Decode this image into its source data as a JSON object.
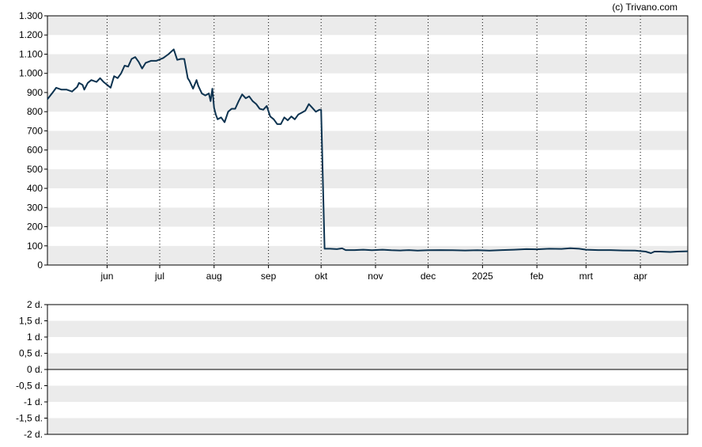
{
  "copyright": "(c) Trivano.com",
  "chart_data": [
    {
      "type": "line",
      "title": "",
      "xlabel": "",
      "ylabel": "",
      "ylim": [
        0,
        1300
      ],
      "y_ticks": [
        0,
        100,
        200,
        300,
        400,
        500,
        600,
        700,
        800,
        900,
        1000,
        1100,
        1200,
        1300
      ],
      "y_tick_labels": [
        "0",
        "100",
        "200",
        "300",
        "400",
        "500",
        "600",
        "700",
        "800",
        "900",
        "1.000",
        "1.100",
        "1.200",
        "1.300"
      ],
      "x_range": [
        "2024-04-28",
        "2025-04-28"
      ],
      "x_ticks": [
        {
          "label": "jun",
          "date": "2024-06-01"
        },
        {
          "label": "jul",
          "date": "2024-07-01"
        },
        {
          "label": "aug",
          "date": "2024-08-01"
        },
        {
          "label": "sep",
          "date": "2024-09-01"
        },
        {
          "label": "okt",
          "date": "2024-10-01"
        },
        {
          "label": "nov",
          "date": "2024-11-01"
        },
        {
          "label": "dec",
          "date": "2024-12-01"
        },
        {
          "label": "2025",
          "date": "2025-01-01"
        },
        {
          "label": "feb",
          "date": "2025-02-01"
        },
        {
          "label": "mrt",
          "date": "2025-03-01"
        },
        {
          "label": "apr",
          "date": "2025-04-01"
        }
      ],
      "grid": "horizontal alternating bands, vertical dotted lines at month ticks",
      "line_color": "#0d3350",
      "series": [
        {
          "points": [
            [
              "2024-04-28",
              865
            ],
            [
              "2024-05-01",
              900
            ],
            [
              "2024-05-03",
              925
            ],
            [
              "2024-05-06",
              915
            ],
            [
              "2024-05-09",
              915
            ],
            [
              "2024-05-12",
              905
            ],
            [
              "2024-05-15",
              930
            ],
            [
              "2024-05-16",
              950
            ],
            [
              "2024-05-18",
              940
            ],
            [
              "2024-05-19",
              915
            ],
            [
              "2024-05-21",
              950
            ],
            [
              "2024-05-23",
              965
            ],
            [
              "2024-05-26",
              955
            ],
            [
              "2024-05-28",
              975
            ],
            [
              "2024-05-30",
              955
            ],
            [
              "2024-06-01",
              940
            ],
            [
              "2024-06-03",
              925
            ],
            [
              "2024-06-05",
              985
            ],
            [
              "2024-06-07",
              975
            ],
            [
              "2024-06-09",
              1000
            ],
            [
              "2024-06-11",
              1040
            ],
            [
              "2024-06-13",
              1035
            ],
            [
              "2024-06-15",
              1075
            ],
            [
              "2024-06-17",
              1085
            ],
            [
              "2024-06-19",
              1060
            ],
            [
              "2024-06-21",
              1025
            ],
            [
              "2024-06-23",
              1055
            ],
            [
              "2024-06-26",
              1065
            ],
            [
              "2024-06-29",
              1065
            ],
            [
              "2024-07-03",
              1080
            ],
            [
              "2024-07-06",
              1100
            ],
            [
              "2024-07-09",
              1125
            ],
            [
              "2024-07-11",
              1070
            ],
            [
              "2024-07-13",
              1075
            ],
            [
              "2024-07-15",
              1075
            ],
            [
              "2024-07-17",
              975
            ],
            [
              "2024-07-18",
              960
            ],
            [
              "2024-07-20",
              920
            ],
            [
              "2024-07-22",
              965
            ],
            [
              "2024-07-23",
              935
            ],
            [
              "2024-07-25",
              895
            ],
            [
              "2024-07-27",
              885
            ],
            [
              "2024-07-29",
              895
            ],
            [
              "2024-07-30",
              855
            ],
            [
              "2024-07-31",
              920
            ],
            [
              "2024-08-01",
              820
            ],
            [
              "2024-08-02",
              785
            ],
            [
              "2024-08-03",
              760
            ],
            [
              "2024-08-05",
              770
            ],
            [
              "2024-08-07",
              745
            ],
            [
              "2024-08-09",
              800
            ],
            [
              "2024-08-11",
              815
            ],
            [
              "2024-08-13",
              815
            ],
            [
              "2024-08-15",
              855
            ],
            [
              "2024-08-17",
              890
            ],
            [
              "2024-08-19",
              870
            ],
            [
              "2024-08-21",
              880
            ],
            [
              "2024-08-23",
              855
            ],
            [
              "2024-08-25",
              840
            ],
            [
              "2024-08-27",
              815
            ],
            [
              "2024-08-29",
              810
            ],
            [
              "2024-08-31",
              830
            ],
            [
              "2024-09-02",
              775
            ],
            [
              "2024-09-04",
              760
            ],
            [
              "2024-09-06",
              735
            ],
            [
              "2024-09-08",
              735
            ],
            [
              "2024-09-10",
              770
            ],
            [
              "2024-09-12",
              755
            ],
            [
              "2024-09-14",
              775
            ],
            [
              "2024-09-16",
              760
            ],
            [
              "2024-09-18",
              785
            ],
            [
              "2024-09-20",
              795
            ],
            [
              "2024-09-22",
              805
            ],
            [
              "2024-09-24",
              840
            ],
            [
              "2024-09-26",
              820
            ],
            [
              "2024-09-28",
              800
            ],
            [
              "2024-09-30",
              810
            ],
            [
              "2024-10-01",
              810
            ],
            [
              "2024-10-03",
              85
            ],
            [
              "2024-10-06",
              85
            ],
            [
              "2024-10-10",
              83
            ],
            [
              "2024-10-13",
              87
            ],
            [
              "2024-10-15",
              78
            ],
            [
              "2024-10-20",
              78
            ],
            [
              "2024-10-25",
              80
            ],
            [
              "2024-10-30",
              77
            ],
            [
              "2024-11-05",
              80
            ],
            [
              "2024-11-10",
              77
            ],
            [
              "2024-11-15",
              76
            ],
            [
              "2024-11-20",
              78
            ],
            [
              "2024-11-25",
              75
            ],
            [
              "2024-12-01",
              77
            ],
            [
              "2024-12-08",
              78
            ],
            [
              "2024-12-15",
              77
            ],
            [
              "2024-12-22",
              76
            ],
            [
              "2024-12-29",
              77
            ],
            [
              "2025-01-05",
              75
            ],
            [
              "2025-01-12",
              78
            ],
            [
              "2025-01-19",
              80
            ],
            [
              "2025-01-26",
              83
            ],
            [
              "2025-02-01",
              82
            ],
            [
              "2025-02-08",
              85
            ],
            [
              "2025-02-15",
              84
            ],
            [
              "2025-02-20",
              88
            ],
            [
              "2025-02-25",
              85
            ],
            [
              "2025-03-01",
              80
            ],
            [
              "2025-03-08",
              78
            ],
            [
              "2025-03-15",
              78
            ],
            [
              "2025-03-22",
              76
            ],
            [
              "2025-03-29",
              75
            ],
            [
              "2025-04-04",
              70
            ],
            [
              "2025-04-07",
              62
            ],
            [
              "2025-04-09",
              70
            ],
            [
              "2025-04-12",
              70
            ],
            [
              "2025-04-18",
              68
            ],
            [
              "2025-04-22",
              70
            ],
            [
              "2025-04-28",
              72
            ]
          ]
        }
      ]
    },
    {
      "type": "line",
      "title": "",
      "ylim": [
        -2,
        2
      ],
      "y_ticks": [
        2,
        1.5,
        1,
        0.5,
        0,
        -0.5,
        -1,
        -1.5,
        -2
      ],
      "y_tick_labels": [
        "2 d.",
        "1,5 d.",
        "1 d.",
        "0,5 d.",
        "0 d.",
        "-0,5 d.",
        "-1 d.",
        "-1,5 d.",
        "-2 d."
      ],
      "series": [],
      "zero_line": true
    }
  ]
}
